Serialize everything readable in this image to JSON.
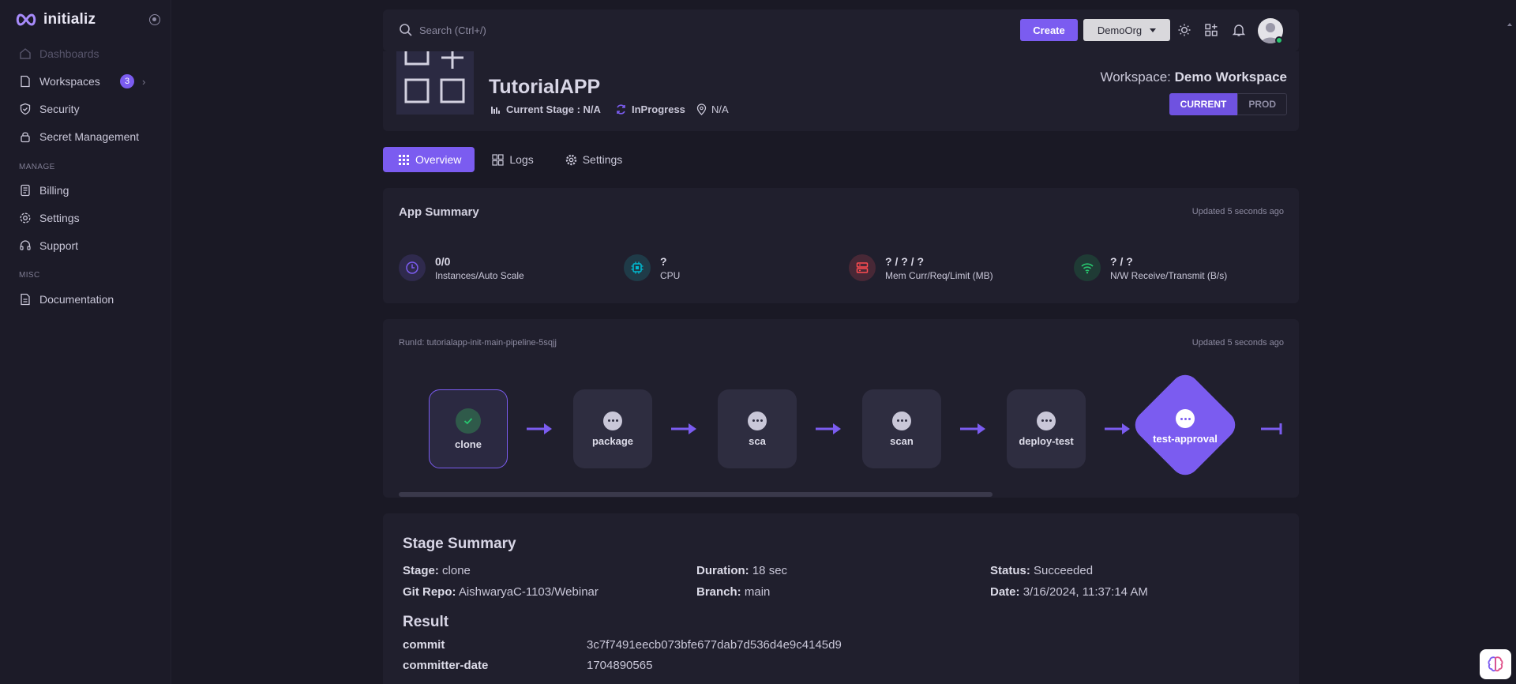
{
  "brand": {
    "name": "initializ"
  },
  "sidebar": {
    "items": [
      {
        "label": "Dashboards"
      },
      {
        "label": "Workspaces",
        "badge": "3"
      },
      {
        "label": "Security"
      },
      {
        "label": "Secret Management"
      },
      {
        "label": "Billing"
      },
      {
        "label": "Settings"
      },
      {
        "label": "Support"
      },
      {
        "label": "Documentation"
      }
    ],
    "sections": {
      "manage": "MANAGE",
      "misc": "MISC"
    }
  },
  "topbar": {
    "search_placeholder": "Search (Ctrl+/)",
    "create_label": "Create",
    "org_label": "DemoOrg"
  },
  "app": {
    "title": "TutorialAPP",
    "stage_label": "Current Stage : N/A",
    "status": "InProgress",
    "location": "N/A",
    "workspace_prefix": "Workspace:",
    "workspace_name": "Demo Workspace",
    "env_current": "CURRENT",
    "env_prod": "PROD"
  },
  "tabs": [
    {
      "label": "Overview"
    },
    {
      "label": "Logs"
    },
    {
      "label": "Settings"
    }
  ],
  "summary": {
    "title": "App Summary",
    "updated": "Updated 5 seconds ago",
    "stats": [
      {
        "value": "0/0",
        "label": "Instances/Auto Scale",
        "icon": "clock-icon",
        "color": "#7b5cf0"
      },
      {
        "value": "?",
        "label": "CPU",
        "icon": "cpu-icon",
        "color": "#00bad1"
      },
      {
        "value": "? / ? / ?",
        "label": "Mem Curr/Req/Limit (MB)",
        "icon": "server-icon",
        "color": "#ff4c51"
      },
      {
        "value": "? / ?",
        "label": "N/W Receive/Transmit (B/s)",
        "icon": "wifi-icon",
        "color": "#28c76f"
      }
    ]
  },
  "pipeline": {
    "run_id": "RunId: tutorialapp-init-main-pipeline-5sqjj",
    "updated": "Updated 5 seconds ago",
    "stages": [
      {
        "name": "clone",
        "state": "succeeded"
      },
      {
        "name": "package",
        "state": "pending"
      },
      {
        "name": "sca",
        "state": "pending"
      },
      {
        "name": "scan",
        "state": "pending"
      },
      {
        "name": "deploy-test",
        "state": "pending"
      },
      {
        "name": "test-approval",
        "state": "approval"
      }
    ]
  },
  "stage_summary": {
    "title": "Stage Summary",
    "stage_key": "Stage:",
    "stage_val": "clone",
    "duration_key": "Duration:",
    "duration_val": "18 sec",
    "status_key": "Status:",
    "status_val": "Succeeded",
    "repo_key": "Git Repo:",
    "repo_val": "AishwaryaC-1103/Webinar",
    "branch_key": "Branch:",
    "branch_val": "main",
    "date_key": "Date:",
    "date_val": "3/16/2024, 11:37:14 AM",
    "result_title": "Result",
    "results": [
      {
        "key": "commit",
        "value": "3c7f7491eecb073bfe677dab7d536d4e9c4145d9"
      },
      {
        "key": "committer-date",
        "value": "1704890565"
      }
    ]
  },
  "colors": {
    "accent": "#7b5cf0",
    "background": "#1a1925",
    "card": "#201f2d"
  }
}
